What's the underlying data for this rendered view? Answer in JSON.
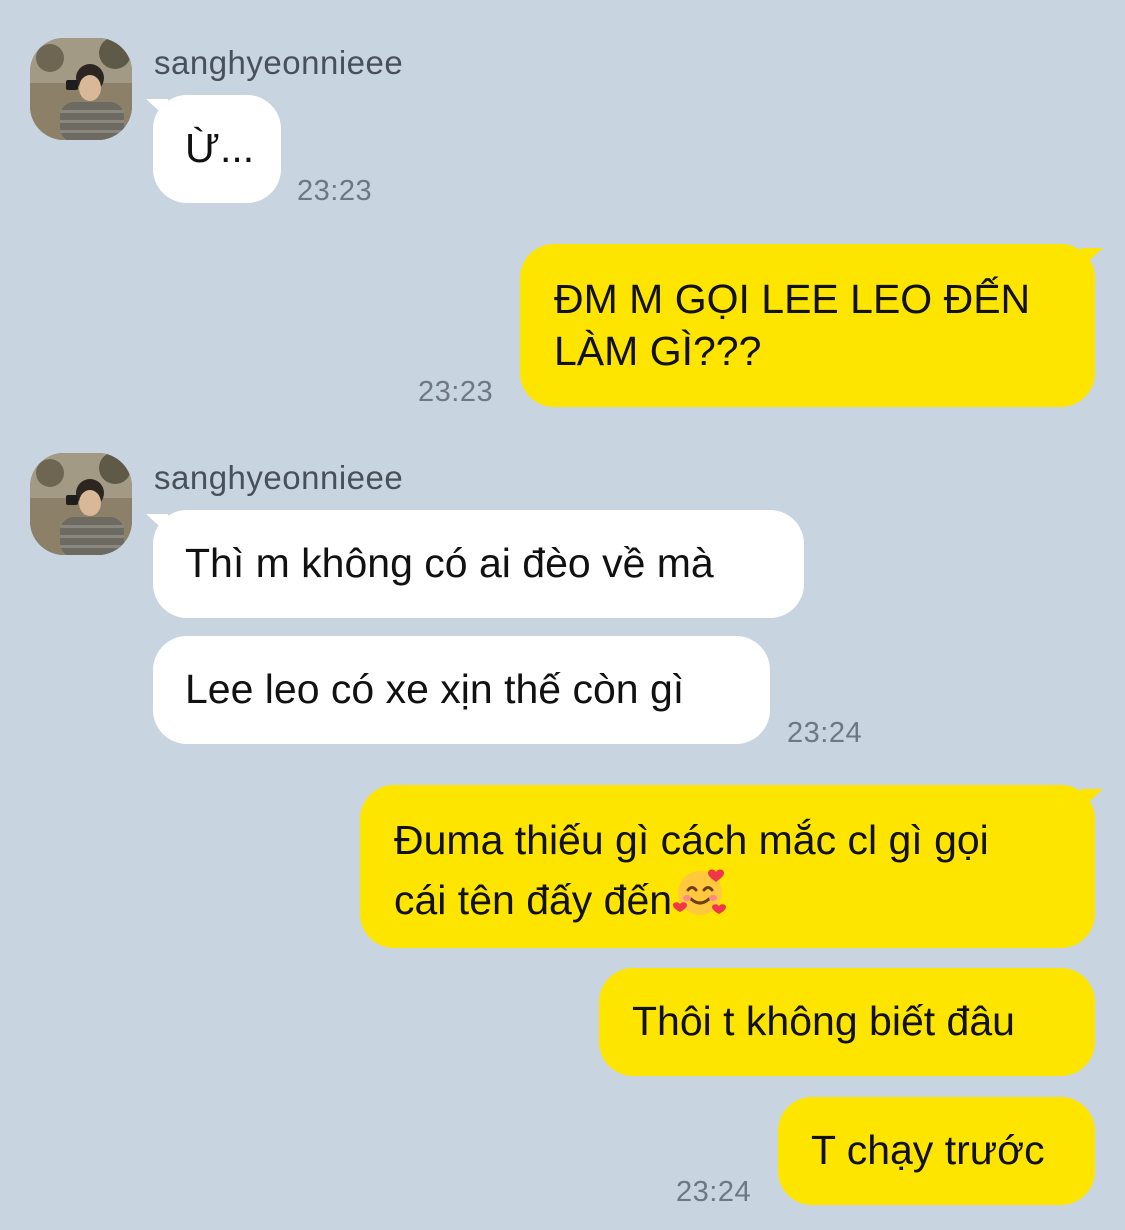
{
  "contact": {
    "name": "sanghyeonnieee"
  },
  "colors": {
    "background": "#c8d5e1",
    "incoming_bubble": "#ffffff",
    "outgoing_bubble": "#fee500",
    "timestamp": "#6f7780"
  },
  "messages": [
    {
      "direction": "incoming",
      "text": "Ừ...",
      "time": "23:23"
    },
    {
      "direction": "outgoing",
      "lines": [
        "ĐM M GỌI LEE LEO ĐẾN",
        "LÀM GÌ???"
      ],
      "time": "23:23"
    },
    {
      "direction": "incoming",
      "text": "Thì m không có ai đèo về mà"
    },
    {
      "direction": "incoming",
      "text": "Lee leo có xe xịn thế còn gì",
      "time": "23:24"
    },
    {
      "direction": "outgoing",
      "lines": [
        "Đuma thiếu gì cách mắc cl gì gọi",
        "cái tên đấy đến"
      ],
      "emoji": "smiling-face-with-hearts"
    },
    {
      "direction": "outgoing",
      "text": "Thôi t không biết đâu"
    },
    {
      "direction": "outgoing",
      "text": "T chạy trước",
      "time": "23:24"
    }
  ]
}
